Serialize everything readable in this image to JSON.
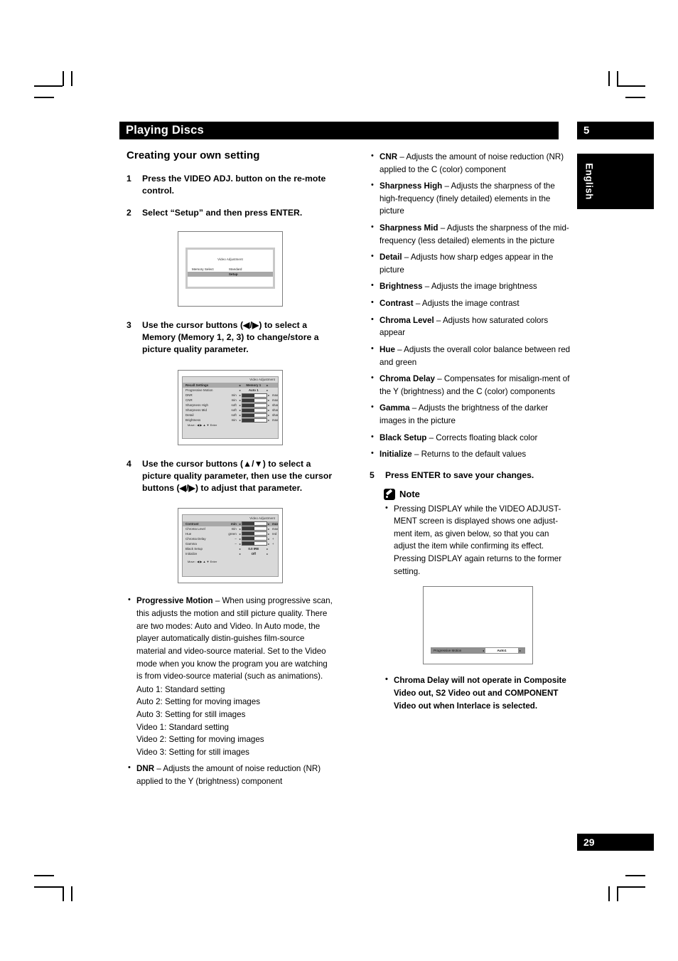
{
  "header": {
    "chapter_title": "Playing Discs",
    "chapter_number": "5",
    "language_tab": "English"
  },
  "footer": {
    "page_number": "29"
  },
  "left_column": {
    "section_title": "Creating your own setting",
    "steps": [
      {
        "num": "1",
        "text": "Press the VIDEO ADJ. button on the re-mote control."
      },
      {
        "num": "2",
        "text": "Select “Setup” and then press ENTER."
      },
      {
        "num": "3",
        "text": "Use the cursor buttons (◀/▶) to select a Memory (Memory 1, 2, 3) to change/store a picture quality parameter."
      },
      {
        "num": "4",
        "text": "Use the cursor buttons (▲/▼) to select a picture quality parameter, then use the cursor buttons (◀/▶) to adjust that parameter."
      }
    ],
    "bullets": [
      {
        "term": "Progressive Motion",
        "desc": " – When using progressive scan, this adjusts the motion and still picture quality. There are two modes: Auto and Video. In Auto mode, the player automatically distin-guishes film-source material and video-source material. Set to the Video mode when you know the program you are watching is from video-source material (such as animations).",
        "sublines": [
          "Auto 1: Standard setting",
          "Auto 2: Setting for moving images",
          "Auto 3: Setting for still images",
          "Video 1: Standard setting",
          "Video 2: Setting for moving images",
          "Video 3: Setting for still images"
        ]
      },
      {
        "term": "DNR",
        "desc": " – Adjusts the amount of noise reduction (NR) applied to the Y (brightness) component",
        "sublines": []
      }
    ]
  },
  "right_column": {
    "bullets": [
      {
        "term": "CNR",
        "desc": " – Adjusts the amount of noise reduction (NR) applied to the C (color) component"
      },
      {
        "term": "Sharpness High",
        "desc": " – Adjusts the sharpness of the high-frequency (finely detailed) elements in the picture"
      },
      {
        "term": "Sharpness Mid",
        "desc": " – Adjusts the sharpness of the mid-frequency (less detailed) elements in the picture"
      },
      {
        "term": "Detail",
        "desc": " – Adjusts how sharp edges appear in the picture"
      },
      {
        "term": "Brightness",
        "desc": " – Adjusts the image brightness"
      },
      {
        "term": "Contrast",
        "desc": " – Adjusts the image contrast"
      },
      {
        "term": "Chroma Level",
        "desc": " – Adjusts how saturated colors appear"
      },
      {
        "term": "Hue",
        "desc": " – Adjusts the overall color balance between red and green"
      },
      {
        "term": "Chroma Delay",
        "desc": " – Compensates for misalign-ment of the Y (brightness) and the C (color) components"
      },
      {
        "term": "Gamma",
        "desc": " – Adjusts the brightness of the darker images in the picture"
      },
      {
        "term": "Black Setup",
        "desc": " – Corrects floating black color"
      },
      {
        "term": "Initialize",
        "desc": " – Returns to the default values"
      }
    ],
    "step5": {
      "num": "5",
      "text": "Press ENTER to save your changes."
    },
    "note": {
      "title": "Note",
      "items": [
        "Pressing DISPLAY while the VIDEO ADJUST-MENT screen is displayed shows one adjust-ment item, as given below, so that you can adjust the item while confirming its effect. Pressing DISPLAY again returns to the former setting.",
        "Chroma Delay will not operate in Composite Video out, S2 Video out and COMPONENT Video out when Interlace is selected."
      ]
    }
  },
  "screens": {
    "setup_menu": {
      "title": "Video Adjustment",
      "rows": [
        {
          "label": "Memory Select",
          "value": "Standard",
          "selected": false
        },
        {
          "label": "",
          "value": "Setup",
          "selected": true
        }
      ]
    },
    "memory_menu": {
      "title": "Video Adjustment",
      "rows": [
        {
          "label": "Recall Settings",
          "type": "value",
          "value": "Memory 1",
          "selected": true
        },
        {
          "label": "Progressive Motion",
          "type": "value",
          "value": "Auto 1",
          "selected": false
        },
        {
          "label": "DNR",
          "type": "bar",
          "min": "min",
          "max": "max",
          "fill": 52
        },
        {
          "label": "CNR",
          "type": "bar",
          "min": "min",
          "max": "max",
          "fill": 52
        },
        {
          "label": "Sharpness High",
          "type": "bar",
          "min": "soft",
          "max": "sharp",
          "fill": 52
        },
        {
          "label": "Sharpness Mid",
          "type": "bar",
          "min": "soft",
          "max": "sharp",
          "fill": 52
        },
        {
          "label": "Detail",
          "type": "bar",
          "min": "soft",
          "max": "sharp",
          "fill": 52
        },
        {
          "label": "Brightness",
          "type": "bar",
          "min": "min",
          "max": "max",
          "fill": 52
        }
      ],
      "footer": "Move : ◀ ▶ ▲ ▼  Enter"
    },
    "param_menu": {
      "title": "Video Adjustment",
      "rows": [
        {
          "label": "Contrast",
          "type": "bar",
          "min": "min",
          "max": "max",
          "fill": 52,
          "selected": true
        },
        {
          "label": "Chroma Level",
          "type": "bar",
          "min": "min",
          "max": "max",
          "fill": 52
        },
        {
          "label": "Hue",
          "type": "bar",
          "min": "green",
          "max": "red",
          "fill": 52
        },
        {
          "label": "Chroma Delay",
          "type": "bar",
          "min": "–",
          "max": "+",
          "fill": 52
        },
        {
          "label": "Gamma",
          "type": "bar",
          "min": "–",
          "max": "+",
          "fill": 52
        },
        {
          "label": "Black Setup",
          "type": "value",
          "value": "0.0 IRE"
        },
        {
          "label": "Initialize",
          "type": "value",
          "value": "Off"
        }
      ],
      "footer": "Move : ◀ ▶ ▲ ▼  Enter"
    },
    "display_overlay": {
      "label": "Progressive Motion",
      "value": "Auto1"
    }
  }
}
